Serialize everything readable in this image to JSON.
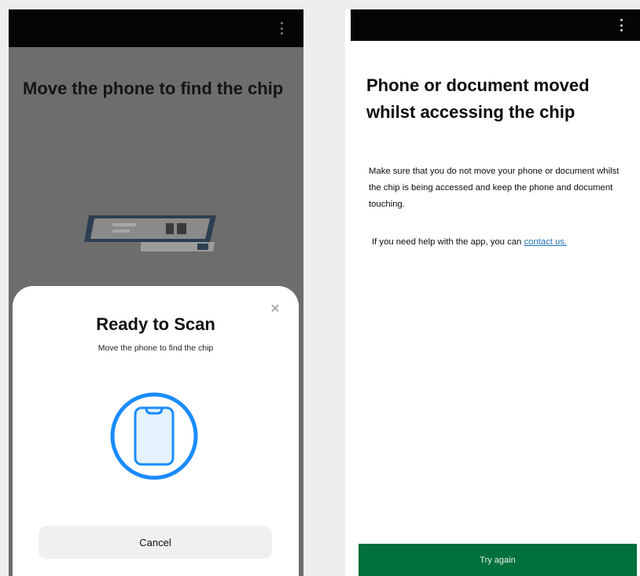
{
  "left_screen": {
    "heading": "Move the phone to find the chip",
    "scan_sheet": {
      "close_glyph": "✕",
      "title": "Ready to Scan",
      "subtitle": "Move the phone to find the chip",
      "icon": "phone-scan-icon",
      "cancel_label": "Cancel"
    }
  },
  "right_screen": {
    "heading": "Phone or document moved whilst accessing the chip",
    "body": "Make sure that you do not move your phone or document whilst the chip is being accessed and keep the phone and document touching.",
    "help_prefix": "If you need help with the app, you can ",
    "help_link": "contact us.",
    "primary_button": "Try again"
  },
  "colors": {
    "scan_blue": "#1a8cff",
    "primary_green": "#00703c",
    "link_blue": "#1d70b8"
  }
}
